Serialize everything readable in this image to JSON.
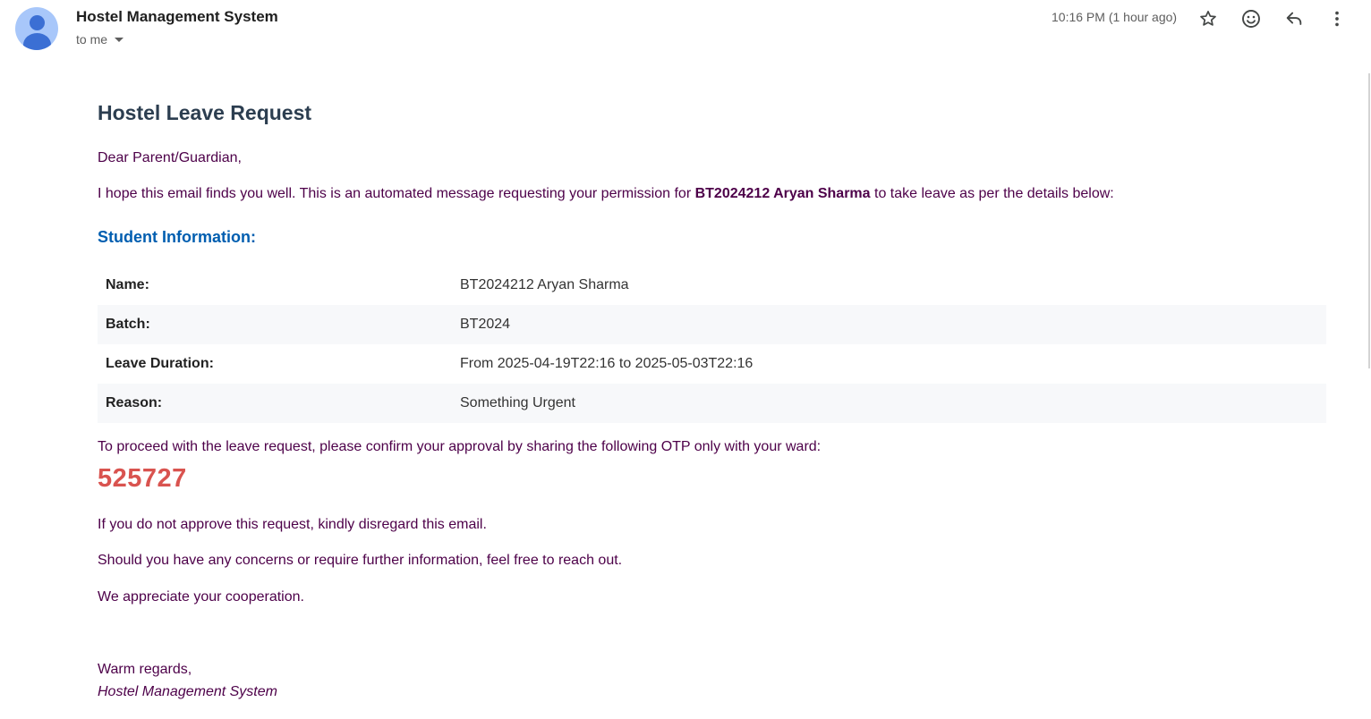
{
  "header": {
    "sender_name": "Hostel Management System",
    "recipient_label": "to me",
    "timestamp": "10:16 PM (1 hour ago)",
    "icons": [
      "person-avatar-icon",
      "star-icon",
      "emoji-icon",
      "reply-icon",
      "more-vert-icon"
    ]
  },
  "email": {
    "title": "Hostel Leave Request",
    "greeting": "Dear Parent/Guardian,",
    "intro_before": "I hope this email finds you well. This is an automated message requesting your permission for ",
    "intro_student": "BT2024212 Aryan Sharma",
    "intro_after": " to take leave as per the details below:",
    "section_title": "Student Information:",
    "info_rows": [
      {
        "label": "Name:",
        "value": "BT2024212 Aryan Sharma"
      },
      {
        "label": "Batch:",
        "value": "BT2024"
      },
      {
        "label": "Leave Duration:",
        "value": "From 2025-04-19T22:16 to 2025-05-03T22:16"
      },
      {
        "label": "Reason:",
        "value": "Something Urgent"
      }
    ],
    "proceed_text": "To proceed with the leave request, please confirm your approval by sharing the following OTP only with your ward:",
    "otp": "525727",
    "disregard_text": "If you do not approve this request, kindly disregard this email.",
    "concerns_text": "Should you have any concerns or require further information, feel free to reach out.",
    "appreciate_text": "We appreciate your cooperation.",
    "regards": "Warm regards,",
    "signature": "Hostel Management System"
  },
  "colors": {
    "body_text": "#4d0049",
    "title": "#2c3e50",
    "section_title": "#005eb0",
    "otp": "#d9534f",
    "avatar_bg": "#a8c7fa",
    "avatar_fg": "#3b6fd4",
    "table_alt_row": "#f7f8fa"
  }
}
